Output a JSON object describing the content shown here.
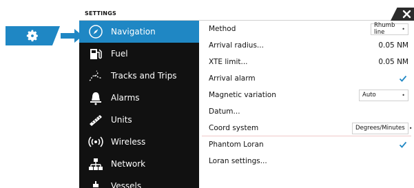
{
  "window": {
    "title": "SETTINGS",
    "close_icon": "close-icon"
  },
  "callout": {
    "gear_icon": "gear-icon",
    "arrow_icon": "arrow-right-icon",
    "accent": "#1f87c4"
  },
  "sidebar": {
    "items": [
      {
        "label": "Navigation",
        "icon": "compass-icon",
        "active": true
      },
      {
        "label": "Fuel",
        "icon": "fuel-pump-icon",
        "active": false
      },
      {
        "label": "Tracks and Trips",
        "icon": "track-icon",
        "active": false
      },
      {
        "label": "Alarms",
        "icon": "bell-icon",
        "active": false
      },
      {
        "label": "Units",
        "icon": "ruler-icon",
        "active": false
      },
      {
        "label": "Wireless",
        "icon": "wireless-icon",
        "active": false
      },
      {
        "label": "Network",
        "icon": "network-icon",
        "active": false
      },
      {
        "label": "Vessels",
        "icon": "vessels-icon",
        "active": false
      }
    ]
  },
  "settings": {
    "method": {
      "label": "Method",
      "value": "Rhumb line"
    },
    "arrival_radius": {
      "label": "Arrival radius...",
      "value": "0.05 NM"
    },
    "xte_limit": {
      "label": "XTE limit...",
      "value": "0.05 NM"
    },
    "arrival_alarm": {
      "label": "Arrival alarm",
      "checked": true
    },
    "magnetic_variation": {
      "label": "Magnetic variation",
      "value": "Auto"
    },
    "datum": {
      "label": "Datum..."
    },
    "coord_system": {
      "label": "Coord system",
      "value": "Degrees/Minutes"
    },
    "phantom_loran": {
      "label": "Phantom Loran",
      "checked": true
    },
    "loran_settings": {
      "label": "Loran settings..."
    }
  },
  "colors": {
    "sidebar_bg": "#111111",
    "active_bg": "#1f87c4",
    "check_color": "#1f87c4"
  }
}
